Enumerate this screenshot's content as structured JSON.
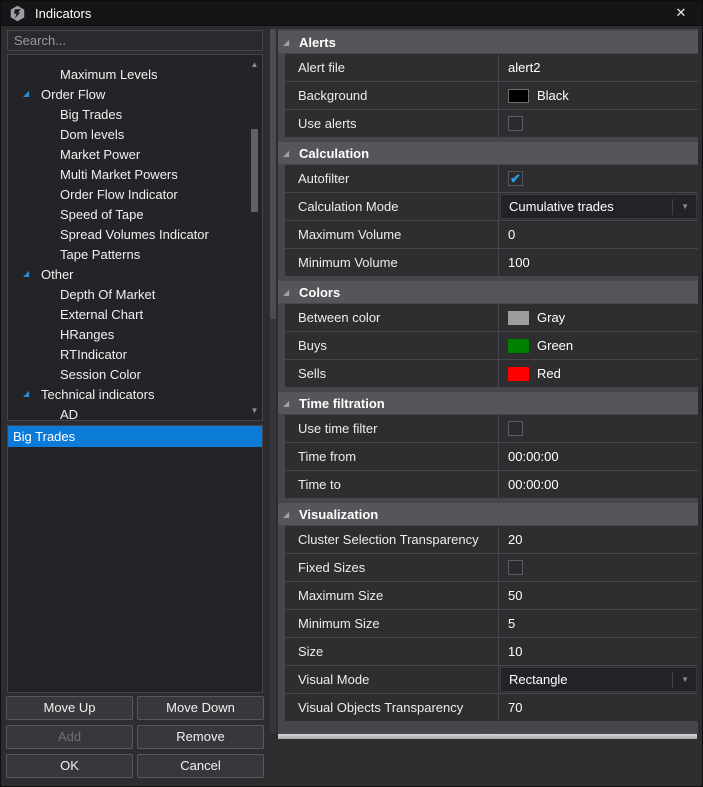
{
  "window": {
    "title": "Indicators",
    "close_glyph": "✕"
  },
  "icons": {
    "expander": "◢",
    "arrow_up": "▲",
    "arrow_down": "▼",
    "check": "✔",
    "grip": "∙∙"
  },
  "search": {
    "placeholder": "Search..."
  },
  "tree": {
    "items": [
      {
        "label": "Maximum Levels",
        "type": "child"
      },
      {
        "label": "Order Flow",
        "type": "group"
      },
      {
        "label": "Big Trades",
        "type": "child"
      },
      {
        "label": "Dom levels",
        "type": "child"
      },
      {
        "label": "Market Power",
        "type": "child"
      },
      {
        "label": "Multi Market Powers",
        "type": "child"
      },
      {
        "label": "Order Flow Indicator",
        "type": "child"
      },
      {
        "label": "Speed of Tape",
        "type": "child"
      },
      {
        "label": "Spread Volumes Indicator",
        "type": "child"
      },
      {
        "label": "Tape Patterns",
        "type": "child"
      },
      {
        "label": "Other",
        "type": "group"
      },
      {
        "label": "Depth Of Market",
        "type": "child"
      },
      {
        "label": "External Chart",
        "type": "child"
      },
      {
        "label": "HRanges",
        "type": "child"
      },
      {
        "label": "RTIndicator",
        "type": "child"
      },
      {
        "label": "Session Color",
        "type": "child"
      },
      {
        "label": "Technical indicators",
        "type": "group"
      },
      {
        "label": "AD",
        "type": "child"
      }
    ]
  },
  "selected_list": {
    "items": [
      {
        "label": "Big Trades",
        "selected": true
      }
    ]
  },
  "buttons": {
    "move_up": "Move Up",
    "move_down": "Move Down",
    "add": "Add",
    "remove": "Remove",
    "ok": "OK",
    "cancel": "Cancel"
  },
  "properties": {
    "sections": [
      {
        "title": "Alerts",
        "rows": [
          {
            "label": "Alert file",
            "type": "text",
            "value": "alert2"
          },
          {
            "label": "Background",
            "type": "color",
            "value": "Black",
            "color": "#000000"
          },
          {
            "label": "Use alerts",
            "type": "checkbox",
            "checked": false
          }
        ]
      },
      {
        "title": "Calculation",
        "rows": [
          {
            "label": "Autofilter",
            "type": "checkbox",
            "checked": true
          },
          {
            "label": "Calculation Mode",
            "type": "dropdown",
            "value": "Cumulative trades"
          },
          {
            "label": "Maximum Volume",
            "type": "text",
            "value": "0"
          },
          {
            "label": "Minimum Volume",
            "type": "text",
            "value": "100"
          }
        ]
      },
      {
        "title": "Colors",
        "rows": [
          {
            "label": "Between color",
            "type": "color",
            "value": "Gray",
            "color": "#9e9e9e"
          },
          {
            "label": "Buys",
            "type": "color",
            "value": "Green",
            "color": "#008000"
          },
          {
            "label": "Sells",
            "type": "color",
            "value": "Red",
            "color": "#ff0000"
          }
        ]
      },
      {
        "title": "Time filtration",
        "rows": [
          {
            "label": "Use time filter",
            "type": "checkbox",
            "checked": false
          },
          {
            "label": "Time from",
            "type": "text",
            "value": "00:00:00"
          },
          {
            "label": "Time to",
            "type": "text",
            "value": "00:00:00"
          }
        ]
      },
      {
        "title": "Visualization",
        "rows": [
          {
            "label": "Cluster Selection Transparency",
            "type": "text",
            "value": "20"
          },
          {
            "label": "Fixed Sizes",
            "type": "checkbox",
            "checked": false
          },
          {
            "label": "Maximum Size",
            "type": "text",
            "value": "50"
          },
          {
            "label": "Minimum Size",
            "type": "text",
            "value": "5"
          },
          {
            "label": "Size",
            "type": "text",
            "value": "10"
          },
          {
            "label": "Visual Mode",
            "type": "dropdown",
            "value": "Rectangle"
          },
          {
            "label": "Visual Objects Transparency",
            "type": "text",
            "value": "70"
          }
        ]
      }
    ]
  },
  "theme": {
    "accent": "#0b7bd7",
    "check_blue": "#2e9be6",
    "header_gray": "#55555a"
  }
}
